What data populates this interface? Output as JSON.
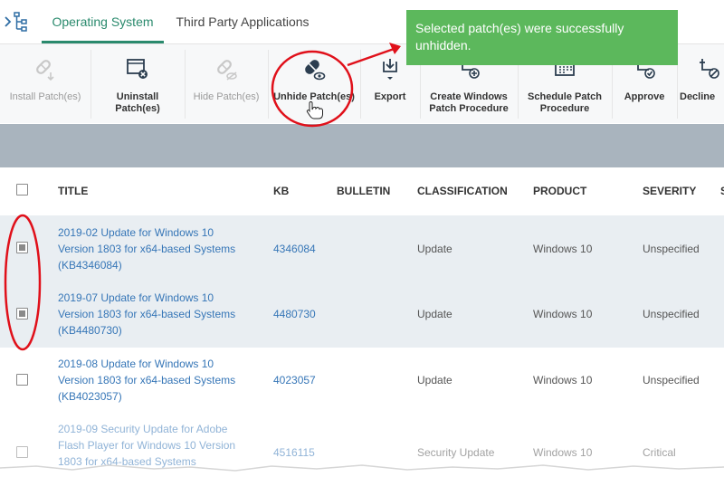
{
  "tabs": [
    {
      "label": "Operating System",
      "active": true
    },
    {
      "label": "Third Party Applications",
      "active": false
    }
  ],
  "toolbar": {
    "install": "Install Patch(es)",
    "uninstall": [
      "Uninstall",
      "Patch(es)"
    ],
    "hide": "Hide Patch(es)",
    "unhide": "Unhide Patch(es)",
    "export": "Export",
    "create": [
      "Create Windows",
      "Patch Procedure"
    ],
    "schedule": [
      "Schedule Patch",
      "Procedure"
    ],
    "approve": "Approve",
    "decline": "Decline"
  },
  "notification": {
    "message": "Selected patch(es) were successfully unhidden."
  },
  "table": {
    "columns": {
      "title": "TITLE",
      "kb": "KB",
      "bulletin": "BULLETIN",
      "classification": "CLASSIFICATION",
      "product": "PRODUCT",
      "severity": "SEVERITY",
      "overflow": "S"
    },
    "rows": [
      {
        "title_lines": [
          "2019-02 Update for Windows 10",
          "Version 1803 for x64-based Systems",
          "(KB4346084)"
        ],
        "kb": "4346084",
        "bulletin": "",
        "classification": "Update",
        "product": "Windows 10",
        "severity": "Unspecified",
        "checked": true
      },
      {
        "title_lines": [
          "2019-07 Update for Windows 10",
          "Version 1803 for x64-based Systems",
          "(KB4480730)"
        ],
        "kb": "4480730",
        "bulletin": "",
        "classification": "Update",
        "product": "Windows 10",
        "severity": "Unspecified",
        "checked": true
      },
      {
        "title_lines": [
          "2019-08 Update for Windows 10",
          "Version 1803 for x64-based Systems",
          "(KB4023057)"
        ],
        "kb": "4023057",
        "bulletin": "",
        "classification": "Update",
        "product": "Windows 10",
        "severity": "Unspecified",
        "checked": false
      },
      {
        "title_lines": [
          "2019-09 Security Update for Adobe",
          "Flash Player for Windows 10 Version",
          "1803 for x64-based Systems"
        ],
        "kb": "4516115",
        "bulletin": "",
        "classification": "Security Update",
        "product": "Windows 10",
        "severity": "Critical",
        "checked": false
      }
    ]
  },
  "colors": {
    "accent": "#2a8a6d",
    "link": "#3676b7",
    "toast": "#5cb85c",
    "band": "#a9b4be",
    "annotation": "#e0101a"
  },
  "icons": {
    "tree_toggle": "tree-toggle-icon",
    "install": "install-patch-icon",
    "uninstall": "uninstall-patch-icon",
    "hide": "hide-patch-icon",
    "unhide": "unhide-patch-icon",
    "export": "export-icon",
    "create": "create-procedure-icon",
    "schedule": "schedule-procedure-icon",
    "approve": "approve-icon",
    "decline": "decline-icon",
    "cursor": "hand-cursor-icon"
  }
}
